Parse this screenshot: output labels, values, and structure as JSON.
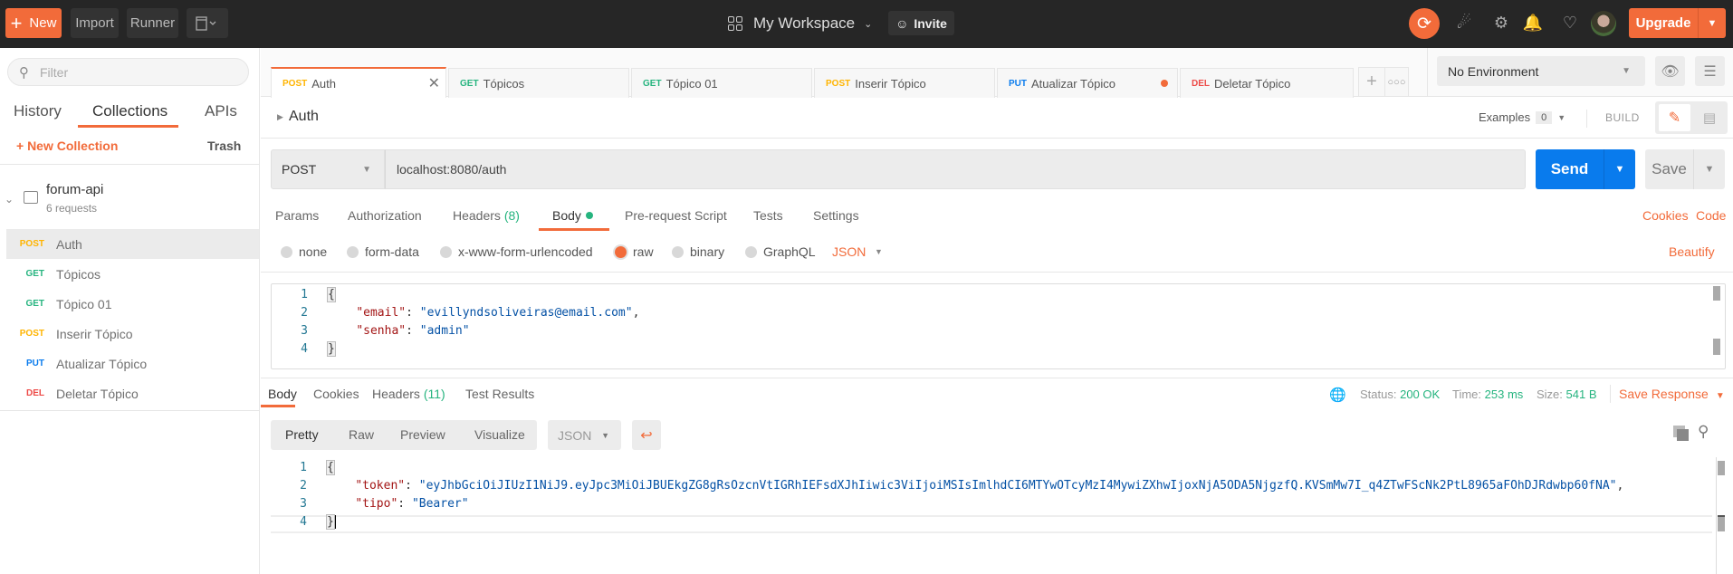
{
  "topbar": {
    "new_label": "New",
    "import_label": "Import",
    "runner_label": "Runner",
    "workspace_label": "My Workspace",
    "invite_label": "Invite",
    "upgrade_label": "Upgrade",
    "icons": [
      "sync-icon",
      "satellite-icon",
      "gear-icon",
      "bell-icon",
      "heart-icon",
      "avatar"
    ]
  },
  "sidebar": {
    "filter_placeholder": "Filter",
    "tabs": [
      {
        "label": "History"
      },
      {
        "label": "Collections",
        "active": true
      },
      {
        "label": "APIs"
      }
    ],
    "new_collection_label": "+ New Collection",
    "trash_label": "Trash",
    "collection": {
      "name": "forum-api",
      "count": "6 requests",
      "requests": [
        {
          "method": "POST",
          "name": "Auth",
          "selected": true
        },
        {
          "method": "GET",
          "name": "Tópicos"
        },
        {
          "method": "GET",
          "name": "Tópico 01"
        },
        {
          "method": "POST",
          "name": "Inserir Tópico"
        },
        {
          "method": "PUT",
          "name": "Atualizar Tópico"
        },
        {
          "method": "DEL",
          "name": "Deletar Tópico"
        }
      ]
    }
  },
  "request_tabs": [
    {
      "method": "POST",
      "name": "Auth",
      "active": true
    },
    {
      "method": "GET",
      "name": "Tópicos"
    },
    {
      "method": "GET",
      "name": "Tópico 01"
    },
    {
      "method": "POST",
      "name": "Inserir Tópico"
    },
    {
      "method": "PUT",
      "name": "Atualizar Tópico",
      "unsaved": true
    },
    {
      "method": "DEL",
      "name": "Deletar Tópico"
    }
  ],
  "environment": {
    "selected": "No Environment"
  },
  "request": {
    "title": "Auth",
    "examples_label": "Examples",
    "examples_count": "0",
    "build_label": "BUILD",
    "method": "POST",
    "url": "localhost:8080/auth",
    "send_label": "Send",
    "save_label": "Save",
    "tabs": {
      "params": "Params",
      "authorization": "Authorization",
      "headers": "Headers",
      "headers_count": "(8)",
      "body": "Body",
      "prerequest": "Pre-request Script",
      "tests": "Tests",
      "settings": "Settings"
    },
    "cookies_label": "Cookies",
    "code_label": "Code",
    "body_types": [
      "none",
      "form-data",
      "x-www-form-urlencoded",
      "raw",
      "binary",
      "GraphQL"
    ],
    "body_type_selected": "raw",
    "language": "JSON",
    "beautify_label": "Beautify",
    "body_lines": {
      "l1": "{",
      "l2_key": "\"email\"",
      "l2_val": "\"evillyndsoliveiras@email.com\"",
      "l3_key": "\"senha\"",
      "l3_val": "\"admin\"",
      "l4": "}"
    }
  },
  "response": {
    "tabs": {
      "body": "Body",
      "cookies": "Cookies",
      "headers": "Headers",
      "headers_count": "(11)",
      "tests": "Test Results"
    },
    "status_label": "Status:",
    "status": "200 OK",
    "time_label": "Time:",
    "time": "253 ms",
    "size_label": "Size:",
    "size": "541 B",
    "save_response_label": "Save Response",
    "views": [
      "Pretty",
      "Raw",
      "Preview",
      "Visualize"
    ],
    "view_selected": "Pretty",
    "format": "JSON",
    "body_lines": {
      "l1": "{",
      "l2_key": "\"token\"",
      "l2_val": "\"eyJhbGciOiJIUzI1NiJ9.eyJpc3MiOiJBUEkgZG8gRsOzcnVtIGRhIEFsdXJhIiwic3ViIjoiMSIsImlhdCI6MTYwOTcyMzI4MywiZXhwIjoxNjA5ODA5NjgzfQ.KVSmMw7I_q4ZTwFScNk2PtL8965aFOhDJRdwbp60fNA\"",
      "l3_key": "\"tipo\"",
      "l3_val": "\"Bearer\"",
      "l4": "}"
    }
  },
  "method_colors": {
    "POST": "#ffb400",
    "GET": "#26b47f",
    "PUT": "#097bed",
    "DEL": "#ed4b48"
  },
  "accent": "#f26b3a"
}
